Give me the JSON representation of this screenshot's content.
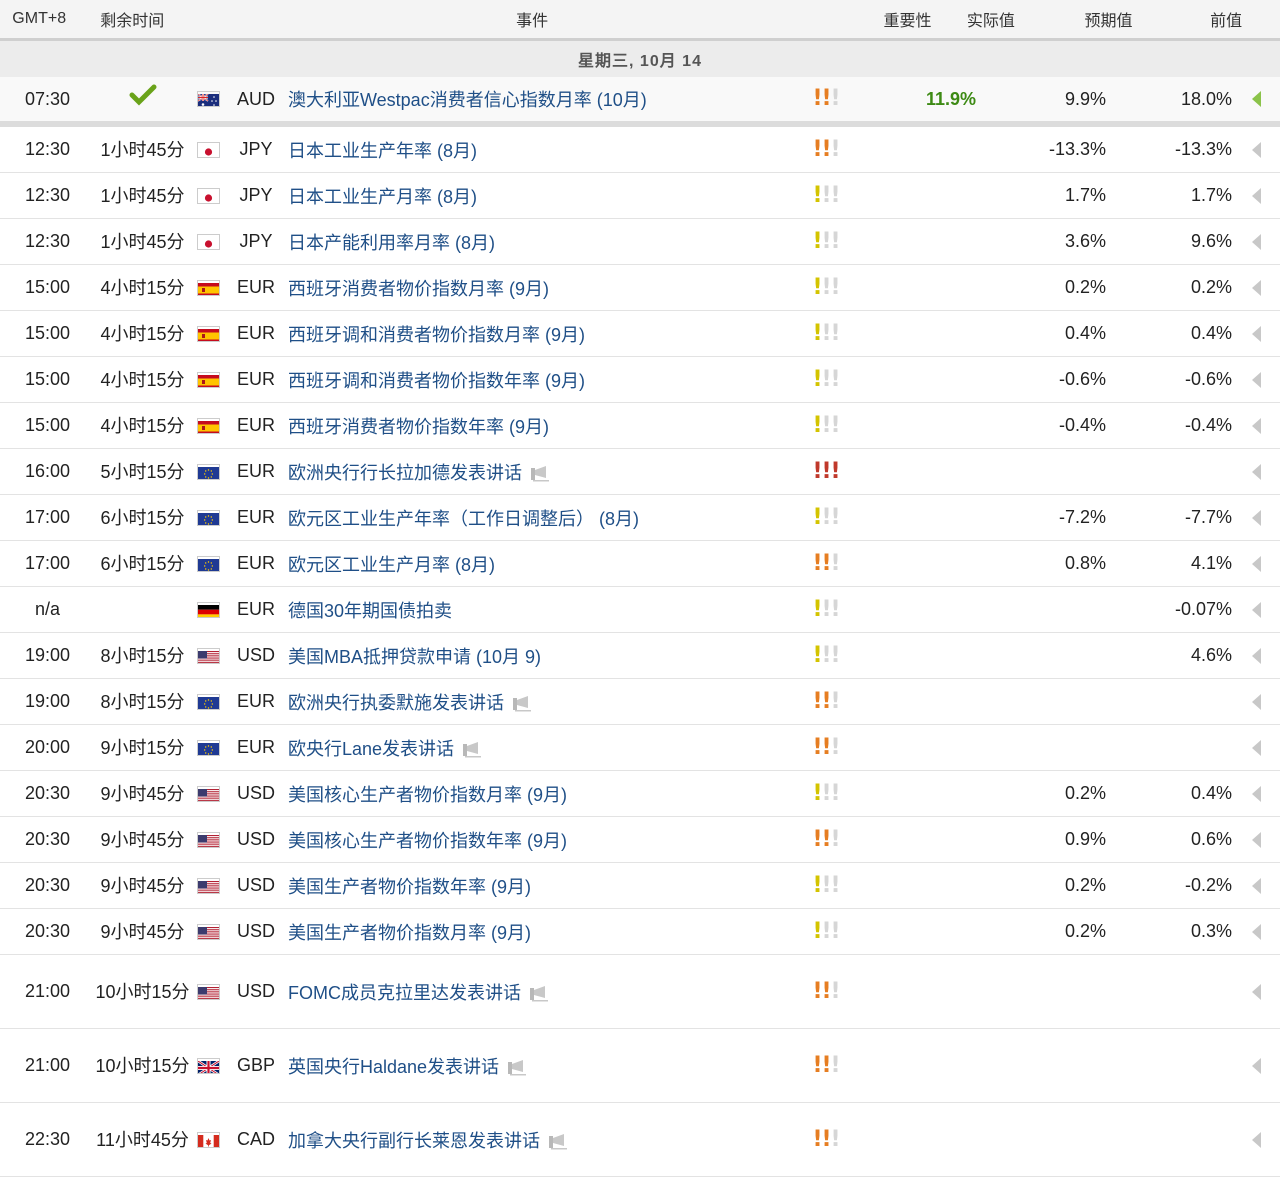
{
  "header": {
    "tz": "GMT+8",
    "remaining": "剩余时间",
    "event": "事件",
    "importance": "重要性",
    "actual": "实际值",
    "forecast": "预期值",
    "previous": "前值"
  },
  "day_label": "星期三, 10月 14",
  "colors": {
    "bang_red": "#c0392b",
    "bang_orange": "#e67e22",
    "bang_yellow": "#d4c400",
    "bang_off": "#d6d6d6",
    "event_link": "#1f4f87",
    "actual_green": "#3d8a14"
  },
  "rows": [
    {
      "time": "07:30",
      "remaining": "",
      "done": true,
      "flag": "au-flag-icon",
      "cur": "AUD",
      "event": "澳大利亚Westpac消费者信心指数月率 (10月)",
      "speech": false,
      "imp": 2,
      "actual": "11.9%",
      "forecast": "9.9%",
      "previous": "18.0%",
      "hl": true
    },
    {
      "time": "12:30",
      "remaining": "1小时45分",
      "flag": "jp-flag-icon",
      "cur": "JPY",
      "event": "日本工业生产年率 (8月)",
      "speech": false,
      "imp": 2,
      "actual": "",
      "forecast": "-13.3%",
      "previous": "-13.3%"
    },
    {
      "time": "12:30",
      "remaining": "1小时45分",
      "flag": "jp-flag-icon",
      "cur": "JPY",
      "event": "日本工业生产月率 (8月)",
      "speech": false,
      "imp": 1,
      "actual": "",
      "forecast": "1.7%",
      "previous": "1.7%"
    },
    {
      "time": "12:30",
      "remaining": "1小时45分",
      "flag": "jp-flag-icon",
      "cur": "JPY",
      "event": "日本产能利用率月率 (8月)",
      "speech": false,
      "imp": 1,
      "actual": "",
      "forecast": "3.6%",
      "previous": "9.6%"
    },
    {
      "time": "15:00",
      "remaining": "4小时15分",
      "flag": "es-flag-icon",
      "cur": "EUR",
      "event": "西班牙消费者物价指数月率 (9月)",
      "speech": false,
      "imp": 1,
      "actual": "",
      "forecast": "0.2%",
      "previous": "0.2%"
    },
    {
      "time": "15:00",
      "remaining": "4小时15分",
      "flag": "es-flag-icon",
      "cur": "EUR",
      "event": "西班牙调和消费者物价指数月率 (9月)",
      "speech": false,
      "imp": 1,
      "actual": "",
      "forecast": "0.4%",
      "previous": "0.4%"
    },
    {
      "time": "15:00",
      "remaining": "4小时15分",
      "flag": "es-flag-icon",
      "cur": "EUR",
      "event": "西班牙调和消费者物价指数年率 (9月)",
      "speech": false,
      "imp": 1,
      "actual": "",
      "forecast": "-0.6%",
      "previous": "-0.6%"
    },
    {
      "time": "15:00",
      "remaining": "4小时15分",
      "flag": "es-flag-icon",
      "cur": "EUR",
      "event": "西班牙消费者物价指数年率 (9月)",
      "speech": false,
      "imp": 1,
      "actual": "",
      "forecast": "-0.4%",
      "previous": "-0.4%"
    },
    {
      "time": "16:00",
      "remaining": "5小时15分",
      "flag": "eu-flag-icon",
      "cur": "EUR",
      "event": "欧洲央行行长拉加德发表讲话",
      "speech": true,
      "imp": 3,
      "actual": "",
      "forecast": "",
      "previous": ""
    },
    {
      "time": "17:00",
      "remaining": "6小时15分",
      "flag": "eu-flag-icon",
      "cur": "EUR",
      "event": "欧元区工业生产年率（工作日调整后） (8月)",
      "speech": false,
      "imp": 1,
      "actual": "",
      "forecast": "-7.2%",
      "previous": "-7.7%"
    },
    {
      "time": "17:00",
      "remaining": "6小时15分",
      "flag": "eu-flag-icon",
      "cur": "EUR",
      "event": "欧元区工业生产月率 (8月)",
      "speech": false,
      "imp": 2,
      "actual": "",
      "forecast": "0.8%",
      "previous": "4.1%"
    },
    {
      "time": "n/a",
      "remaining": "",
      "flag": "de-flag-icon",
      "cur": "EUR",
      "event": "德国30年期国债拍卖",
      "speech": false,
      "imp": 1,
      "actual": "",
      "forecast": "",
      "previous": "-0.07%"
    },
    {
      "time": "19:00",
      "remaining": "8小时15分",
      "flag": "us-flag-icon",
      "cur": "USD",
      "event": "美国MBA抵押贷款申请 (10月 9)",
      "speech": false,
      "imp": 1,
      "actual": "",
      "forecast": "",
      "previous": "4.6%"
    },
    {
      "time": "19:00",
      "remaining": "8小时15分",
      "flag": "eu-flag-icon",
      "cur": "EUR",
      "event": "欧洲央行执委默施发表讲话",
      "speech": true,
      "imp": 2,
      "actual": "",
      "forecast": "",
      "previous": ""
    },
    {
      "time": "20:00",
      "remaining": "9小时15分",
      "flag": "eu-flag-icon",
      "cur": "EUR",
      "event": "欧央行Lane发表讲话",
      "speech": true,
      "imp": 2,
      "actual": "",
      "forecast": "",
      "previous": ""
    },
    {
      "time": "20:30",
      "remaining": "9小时45分",
      "flag": "us-flag-icon",
      "cur": "USD",
      "event": "美国核心生产者物价指数月率 (9月)",
      "speech": false,
      "imp": 1,
      "actual": "",
      "forecast": "0.2%",
      "previous": "0.4%"
    },
    {
      "time": "20:30",
      "remaining": "9小时45分",
      "flag": "us-flag-icon",
      "cur": "USD",
      "event": "美国核心生产者物价指数年率 (9月)",
      "speech": false,
      "imp": 2,
      "actual": "",
      "forecast": "0.9%",
      "previous": "0.6%"
    },
    {
      "time": "20:30",
      "remaining": "9小时45分",
      "flag": "us-flag-icon",
      "cur": "USD",
      "event": "美国生产者物价指数年率 (9月)",
      "speech": false,
      "imp": 1,
      "actual": "",
      "forecast": "0.2%",
      "previous": "-0.2%"
    },
    {
      "time": "20:30",
      "remaining": "9小时45分",
      "flag": "us-flag-icon",
      "cur": "USD",
      "event": "美国生产者物价指数月率 (9月)",
      "speech": false,
      "imp": 1,
      "actual": "",
      "forecast": "0.2%",
      "previous": "0.3%"
    },
    {
      "time": "21:00",
      "remaining": "10小时15分",
      "flag": "us-flag-icon",
      "cur": "USD",
      "event": "FOMC成员克拉里达发表讲话",
      "speech": true,
      "imp": 2,
      "actual": "",
      "forecast": "",
      "previous": "",
      "tall": true
    },
    {
      "time": "21:00",
      "remaining": "10小时15分",
      "flag": "gb-flag-icon",
      "cur": "GBP",
      "event": "英国央行Haldane发表讲话",
      "speech": true,
      "imp": 2,
      "actual": "",
      "forecast": "",
      "previous": "",
      "tall": true
    },
    {
      "time": "22:30",
      "remaining": "11小时45分",
      "flag": "ca-flag-icon",
      "cur": "CAD",
      "event": "加拿大央行副行长莱恩发表讲话",
      "speech": true,
      "imp": 2,
      "actual": "",
      "forecast": "",
      "previous": "",
      "tall": true
    }
  ]
}
